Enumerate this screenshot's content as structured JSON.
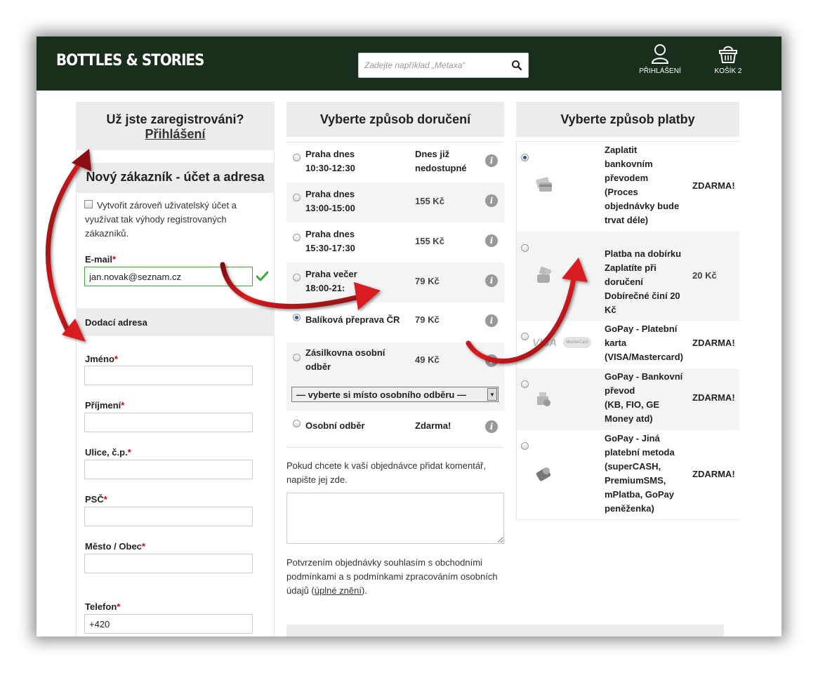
{
  "header": {
    "logo": "BOTTLES & STORIES",
    "search_placeholder": "Zadejte například „Metaxa“",
    "login_label": "PŘIHLÁŠENÍ",
    "cart_label": "KOŠÍK 2"
  },
  "login_box": {
    "question": "Už jste zaregistrováni?",
    "link": "Přihlášení"
  },
  "new_customer": {
    "title": "Nový zákazník - účet a adresa",
    "create_account_text": "Vytvořit zároveň uživatelský účet a využívat tak výhody registrovaných zákazníků.",
    "email_label": "E-mail",
    "email_value": "jan.novak@seznam.cz",
    "delivery_address_label": "Dodací adresa",
    "fields": [
      {
        "label": "Jméno",
        "value": ""
      },
      {
        "label": "Příjmení",
        "value": ""
      },
      {
        "label": "Ulice, č.p.",
        "value": ""
      },
      {
        "label": "PSČ",
        "value": ""
      },
      {
        "label": "Město / Obec",
        "value": ""
      },
      {
        "label": "Telefon",
        "value": "+420"
      }
    ],
    "required_mark": "*"
  },
  "delivery": {
    "title": "Vyberte způsob doručení",
    "options": [
      {
        "name": "Praha dnes\n10:30-12:30",
        "price": "Dnes již\nnedostupné",
        "selected": false
      },
      {
        "name": "Praha dnes\n13:00-15:00",
        "price": "155 Kč",
        "selected": false
      },
      {
        "name": "Praha dnes\n15:30-17:30",
        "price": "155 Kč",
        "selected": false
      },
      {
        "name": "Praha večer\n18:00-21:",
        "price": "79 Kč",
        "selected": false
      },
      {
        "name": "Balíková přeprava ČR",
        "price": "79 Kč",
        "selected": true
      },
      {
        "name": "Zásilkovna osobní\nodběr",
        "price": "49 Kč",
        "selected": false
      }
    ],
    "pickup_select": "— vyberte si místo osobního odběru —",
    "personal": {
      "name": "Osobní odběr",
      "price": "Zdarma!",
      "selected": false
    },
    "info_glyph": "i",
    "comment_prompt": "Pokud chcete k vaší objednávce přidat komentář, napište jej zde.",
    "comment_value": "",
    "terms_before": "Potvrzením objednávky souhlasím s obchodními podmínkami a s podmínkami zpracováním osobních údajů (",
    "terms_link": "úplné znění",
    "terms_after": ")."
  },
  "payment": {
    "title": "Vyberte způsob platby",
    "options": [
      {
        "name": "Zaplatit\nbankovním\npřevodem\n(Proces\nobjednávky bude\ntrvat déle)",
        "price": "ZDARMA!",
        "selected": true,
        "icon": "card-icon"
      },
      {
        "name": "Platba na dobírku\nZaplatíte při\ndoručení\nDobírečné činí 20\nKč",
        "price": "20 Kč",
        "selected": false,
        "icon": "cash-on-delivery-icon"
      },
      {
        "name": "GoPay - Platební\nkarta\n(VISA/Mastercard)",
        "price": "ZDARMA!",
        "selected": false,
        "icon": "visa-mastercard-icon"
      },
      {
        "name": "GoPay - Bankovní\npřevod\n(KB, FIO, GE\nMoney atd)",
        "price": "ZDARMA!",
        "selected": false,
        "icon": "bank-transfer-icon"
      },
      {
        "name": "GoPay - Jiná\nplatební metoda\n(superCASH,\nPremiumSMS,\nmPlatba, GoPay\npeněženka)",
        "price": "ZDARMA!",
        "selected": false,
        "icon": "wallet-icon"
      }
    ],
    "visa_text": "VISA",
    "mastercard_text": "MasterCard"
  },
  "colors": {
    "header_bg": "#1a2e1c",
    "panel_bg": "#ececec",
    "arrow": "#c8151b",
    "success": "#3aaa35"
  }
}
